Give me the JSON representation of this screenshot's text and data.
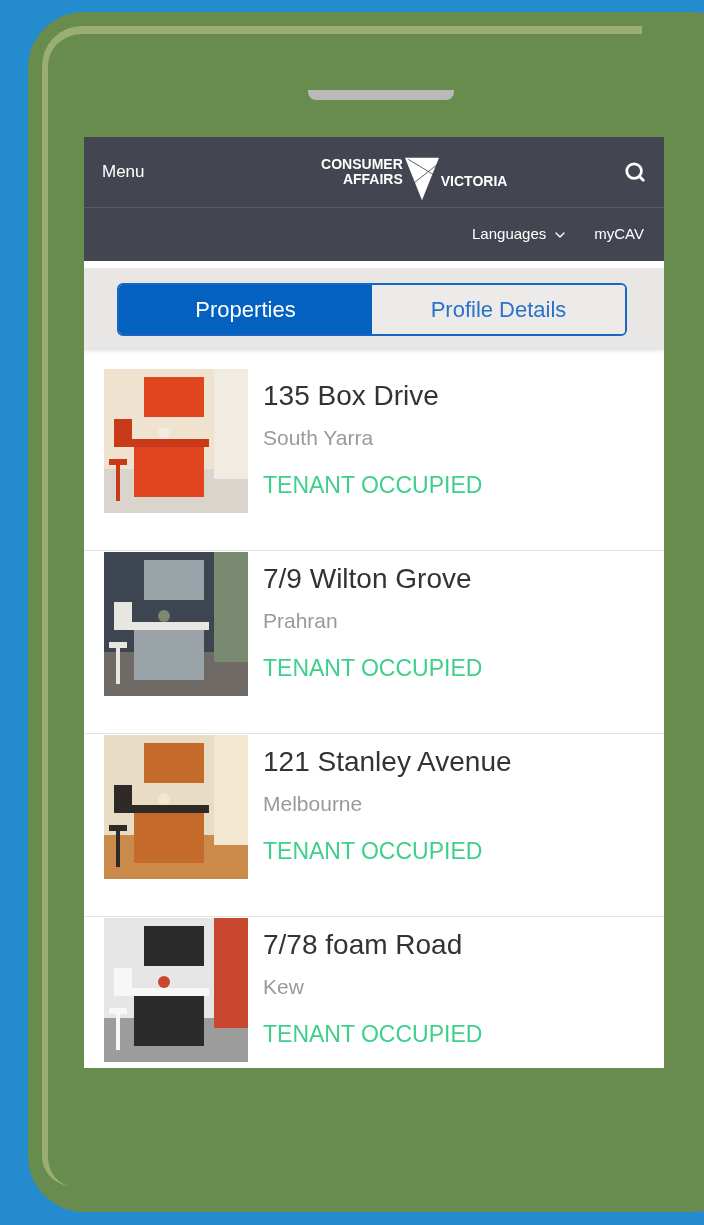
{
  "header": {
    "menu": "Menu",
    "logo": {
      "line_1": "CONSUMER",
      "line_2": "AFFAIRS",
      "line_3": "VICTORIA"
    },
    "links": [
      {
        "label": "Languages",
        "kind": "dropdown"
      },
      {
        "label": "myCAV",
        "kind": "link"
      }
    ]
  },
  "tabs": [
    {
      "label": "Properties",
      "selected": true
    },
    {
      "label": "Profile Details",
      "selected": false
    }
  ],
  "properties": [
    {
      "address": "135 Box Drive",
      "suburb": "South Yarra",
      "status": "TENANT OCCUPIED"
    },
    {
      "address": "7/9 Wilton Grove",
      "suburb": "Prahran",
      "status": "TENANT OCCUPIED"
    },
    {
      "address": "121 Stanley Avenue",
      "suburb": "Melbourne",
      "status": "TENANT OCCUPIED"
    },
    {
      "address": "7/78 foam Road",
      "suburb": "Kew",
      "status": "TENANT OCCUPIED"
    }
  ]
}
